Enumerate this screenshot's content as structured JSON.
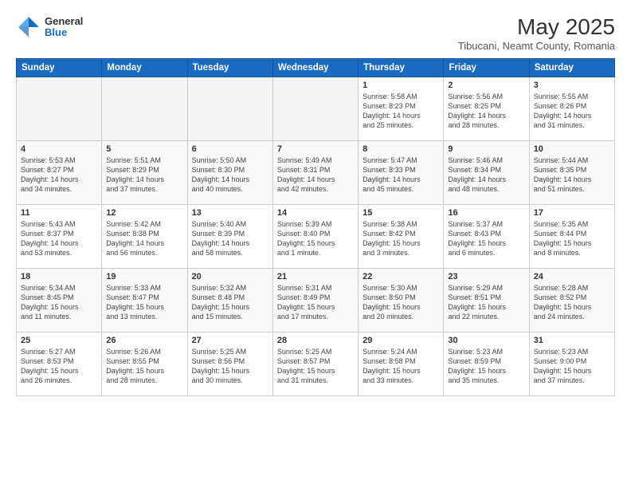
{
  "header": {
    "logo_general": "General",
    "logo_blue": "Blue",
    "main_title": "May 2025",
    "subtitle": "Tibucani, Neamt County, Romania"
  },
  "weekdays": [
    "Sunday",
    "Monday",
    "Tuesday",
    "Wednesday",
    "Thursday",
    "Friday",
    "Saturday"
  ],
  "weeks": [
    [
      {
        "day": "",
        "info": ""
      },
      {
        "day": "",
        "info": ""
      },
      {
        "day": "",
        "info": ""
      },
      {
        "day": "",
        "info": ""
      },
      {
        "day": "1",
        "info": "Sunrise: 5:58 AM\nSunset: 8:23 PM\nDaylight: 14 hours\nand 25 minutes."
      },
      {
        "day": "2",
        "info": "Sunrise: 5:56 AM\nSunset: 8:25 PM\nDaylight: 14 hours\nand 28 minutes."
      },
      {
        "day": "3",
        "info": "Sunrise: 5:55 AM\nSunset: 8:26 PM\nDaylight: 14 hours\nand 31 minutes."
      }
    ],
    [
      {
        "day": "4",
        "info": "Sunrise: 5:53 AM\nSunset: 8:27 PM\nDaylight: 14 hours\nand 34 minutes."
      },
      {
        "day": "5",
        "info": "Sunrise: 5:51 AM\nSunset: 8:29 PM\nDaylight: 14 hours\nand 37 minutes."
      },
      {
        "day": "6",
        "info": "Sunrise: 5:50 AM\nSunset: 8:30 PM\nDaylight: 14 hours\nand 40 minutes."
      },
      {
        "day": "7",
        "info": "Sunrise: 5:49 AM\nSunset: 8:31 PM\nDaylight: 14 hours\nand 42 minutes."
      },
      {
        "day": "8",
        "info": "Sunrise: 5:47 AM\nSunset: 8:33 PM\nDaylight: 14 hours\nand 45 minutes."
      },
      {
        "day": "9",
        "info": "Sunrise: 5:46 AM\nSunset: 8:34 PM\nDaylight: 14 hours\nand 48 minutes."
      },
      {
        "day": "10",
        "info": "Sunrise: 5:44 AM\nSunset: 8:35 PM\nDaylight: 14 hours\nand 51 minutes."
      }
    ],
    [
      {
        "day": "11",
        "info": "Sunrise: 5:43 AM\nSunset: 8:37 PM\nDaylight: 14 hours\nand 53 minutes."
      },
      {
        "day": "12",
        "info": "Sunrise: 5:42 AM\nSunset: 8:38 PM\nDaylight: 14 hours\nand 56 minutes."
      },
      {
        "day": "13",
        "info": "Sunrise: 5:40 AM\nSunset: 8:39 PM\nDaylight: 14 hours\nand 58 minutes."
      },
      {
        "day": "14",
        "info": "Sunrise: 5:39 AM\nSunset: 8:40 PM\nDaylight: 15 hours\nand 1 minute."
      },
      {
        "day": "15",
        "info": "Sunrise: 5:38 AM\nSunset: 8:42 PM\nDaylight: 15 hours\nand 3 minutes."
      },
      {
        "day": "16",
        "info": "Sunrise: 5:37 AM\nSunset: 8:43 PM\nDaylight: 15 hours\nand 6 minutes."
      },
      {
        "day": "17",
        "info": "Sunrise: 5:35 AM\nSunset: 8:44 PM\nDaylight: 15 hours\nand 8 minutes."
      }
    ],
    [
      {
        "day": "18",
        "info": "Sunrise: 5:34 AM\nSunset: 8:45 PM\nDaylight: 15 hours\nand 11 minutes."
      },
      {
        "day": "19",
        "info": "Sunrise: 5:33 AM\nSunset: 8:47 PM\nDaylight: 15 hours\nand 13 minutes."
      },
      {
        "day": "20",
        "info": "Sunrise: 5:32 AM\nSunset: 8:48 PM\nDaylight: 15 hours\nand 15 minutes."
      },
      {
        "day": "21",
        "info": "Sunrise: 5:31 AM\nSunset: 8:49 PM\nDaylight: 15 hours\nand 17 minutes."
      },
      {
        "day": "22",
        "info": "Sunrise: 5:30 AM\nSunset: 8:50 PM\nDaylight: 15 hours\nand 20 minutes."
      },
      {
        "day": "23",
        "info": "Sunrise: 5:29 AM\nSunset: 8:51 PM\nDaylight: 15 hours\nand 22 minutes."
      },
      {
        "day": "24",
        "info": "Sunrise: 5:28 AM\nSunset: 8:52 PM\nDaylight: 15 hours\nand 24 minutes."
      }
    ],
    [
      {
        "day": "25",
        "info": "Sunrise: 5:27 AM\nSunset: 8:53 PM\nDaylight: 15 hours\nand 26 minutes."
      },
      {
        "day": "26",
        "info": "Sunrise: 5:26 AM\nSunset: 8:55 PM\nDaylight: 15 hours\nand 28 minutes."
      },
      {
        "day": "27",
        "info": "Sunrise: 5:25 AM\nSunset: 8:56 PM\nDaylight: 15 hours\nand 30 minutes."
      },
      {
        "day": "28",
        "info": "Sunrise: 5:25 AM\nSunset: 8:57 PM\nDaylight: 15 hours\nand 31 minutes."
      },
      {
        "day": "29",
        "info": "Sunrise: 5:24 AM\nSunset: 8:58 PM\nDaylight: 15 hours\nand 33 minutes."
      },
      {
        "day": "30",
        "info": "Sunrise: 5:23 AM\nSunset: 8:59 PM\nDaylight: 15 hours\nand 35 minutes."
      },
      {
        "day": "31",
        "info": "Sunrise: 5:23 AM\nSunset: 9:00 PM\nDaylight: 15 hours\nand 37 minutes."
      }
    ]
  ]
}
